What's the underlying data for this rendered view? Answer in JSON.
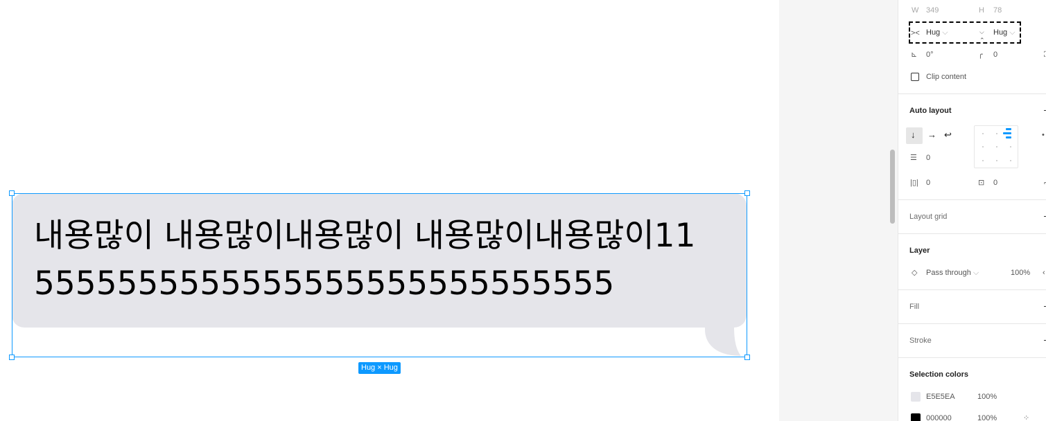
{
  "canvas": {
    "bubble_text_line1": "내용많이 내용많이내용많이 내용많이내용많이11",
    "bubble_text_line2": "5555555555555555555555555555",
    "size_badge": "Hug × Hug",
    "bubble_color": "#E5E5EA",
    "selection_color": "#0D99FF"
  },
  "panel": {
    "w_label": "W",
    "w_value": "349",
    "h_label": "H",
    "h_value": "78",
    "width_mode": "Hug",
    "height_mode": "Hug",
    "rotation": "0°",
    "corner_radius": "0",
    "clip_content": "Clip content",
    "auto_layout_title": "Auto layout",
    "spacing": "0",
    "padding_h": "0",
    "padding_v": "0",
    "layout_grid_title": "Layout grid",
    "layer_title": "Layer",
    "blend_mode": "Pass through",
    "layer_opacity": "100%",
    "fill_title": "Fill",
    "stroke_title": "Stroke",
    "selection_colors_title": "Selection colors",
    "colors": [
      {
        "hex": "E5E5EA",
        "opacity": "100%",
        "swatch": "#E5E5EA"
      },
      {
        "hex": "000000",
        "opacity": "100%",
        "swatch": "#000000"
      }
    ]
  },
  "icons": {
    "arrow_down": "↓",
    "arrow_right": "→",
    "wrap": "↩",
    "chevron": "⌵"
  }
}
